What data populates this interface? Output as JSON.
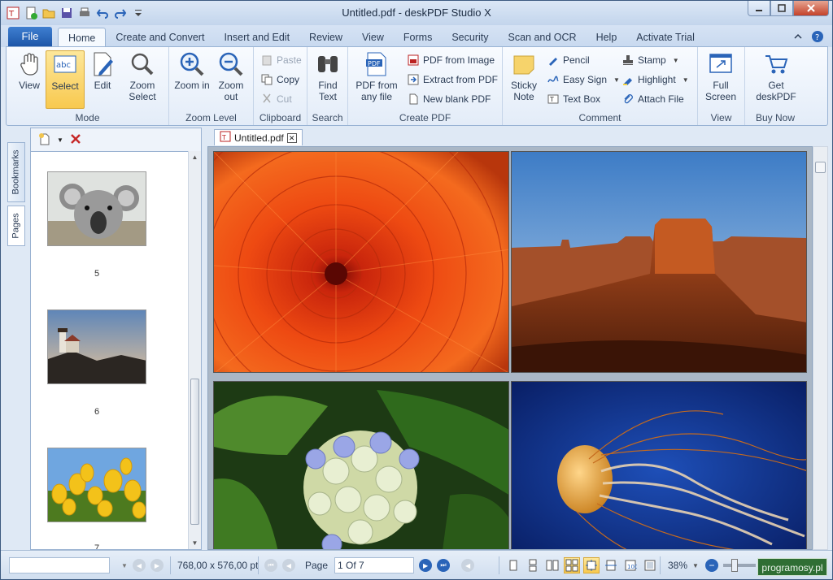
{
  "window": {
    "title": "Untitled.pdf - deskPDF Studio X"
  },
  "tabs": {
    "file": "File",
    "items": [
      "Home",
      "Create and Convert",
      "Insert and Edit",
      "Review",
      "View",
      "Forms",
      "Security",
      "Scan and OCR",
      "Help",
      "Activate Trial"
    ],
    "active": "Home"
  },
  "ribbon": {
    "mode": {
      "label": "Mode",
      "view": "View",
      "select": "Select",
      "edit": "Edit",
      "zoom_select": "Zoom Select"
    },
    "zoom": {
      "label": "Zoom Level",
      "zoom_in": "Zoom in",
      "zoom_out": "Zoom out"
    },
    "clipboard": {
      "label": "Clipboard",
      "paste": "Paste",
      "copy": "Copy",
      "cut": "Cut"
    },
    "search": {
      "label": "Search",
      "find_text": "Find Text"
    },
    "create_pdf": {
      "label": "Create PDF",
      "pdf_from_any_file": "PDF from any file",
      "pdf_from_image": "PDF from Image",
      "extract_from_pdf": "Extract from PDF",
      "new_blank_pdf": "New blank PDF"
    },
    "comment": {
      "label": "Comment",
      "sticky_note": "Sticky Note",
      "pencil": "Pencil",
      "easy_sign": "Easy Sign",
      "text_box": "Text Box",
      "stamp": "Stamp",
      "highlight": "Highlight",
      "attach_file": "Attach File"
    },
    "view": {
      "label": "View",
      "full_screen": "Full Screen"
    },
    "buy": {
      "label": "Buy Now",
      "get_deskpdf": "Get deskPDF"
    }
  },
  "side_tabs": {
    "bookmarks": "Bookmarks",
    "pages": "Pages"
  },
  "thumbnails": [
    {
      "number": "5",
      "subject": "koala"
    },
    {
      "number": "6",
      "subject": "lighthouse"
    },
    {
      "number": "7",
      "subject": "tulips"
    }
  ],
  "document": {
    "tab_label": "Untitled.pdf",
    "pages": [
      "chrysanthemum",
      "desert",
      "hydrangeas",
      "jellyfish"
    ]
  },
  "status": {
    "dimensions": "768,00 x 576,00 pt",
    "page_label": "Page",
    "page_value": "1 Of 7",
    "zoom": "38%",
    "watermark": "programosy.pl"
  },
  "colors": {
    "file_tab": "#2a64b8",
    "select_highlight": "#f8c94f",
    "accent_red": "#c62828"
  }
}
